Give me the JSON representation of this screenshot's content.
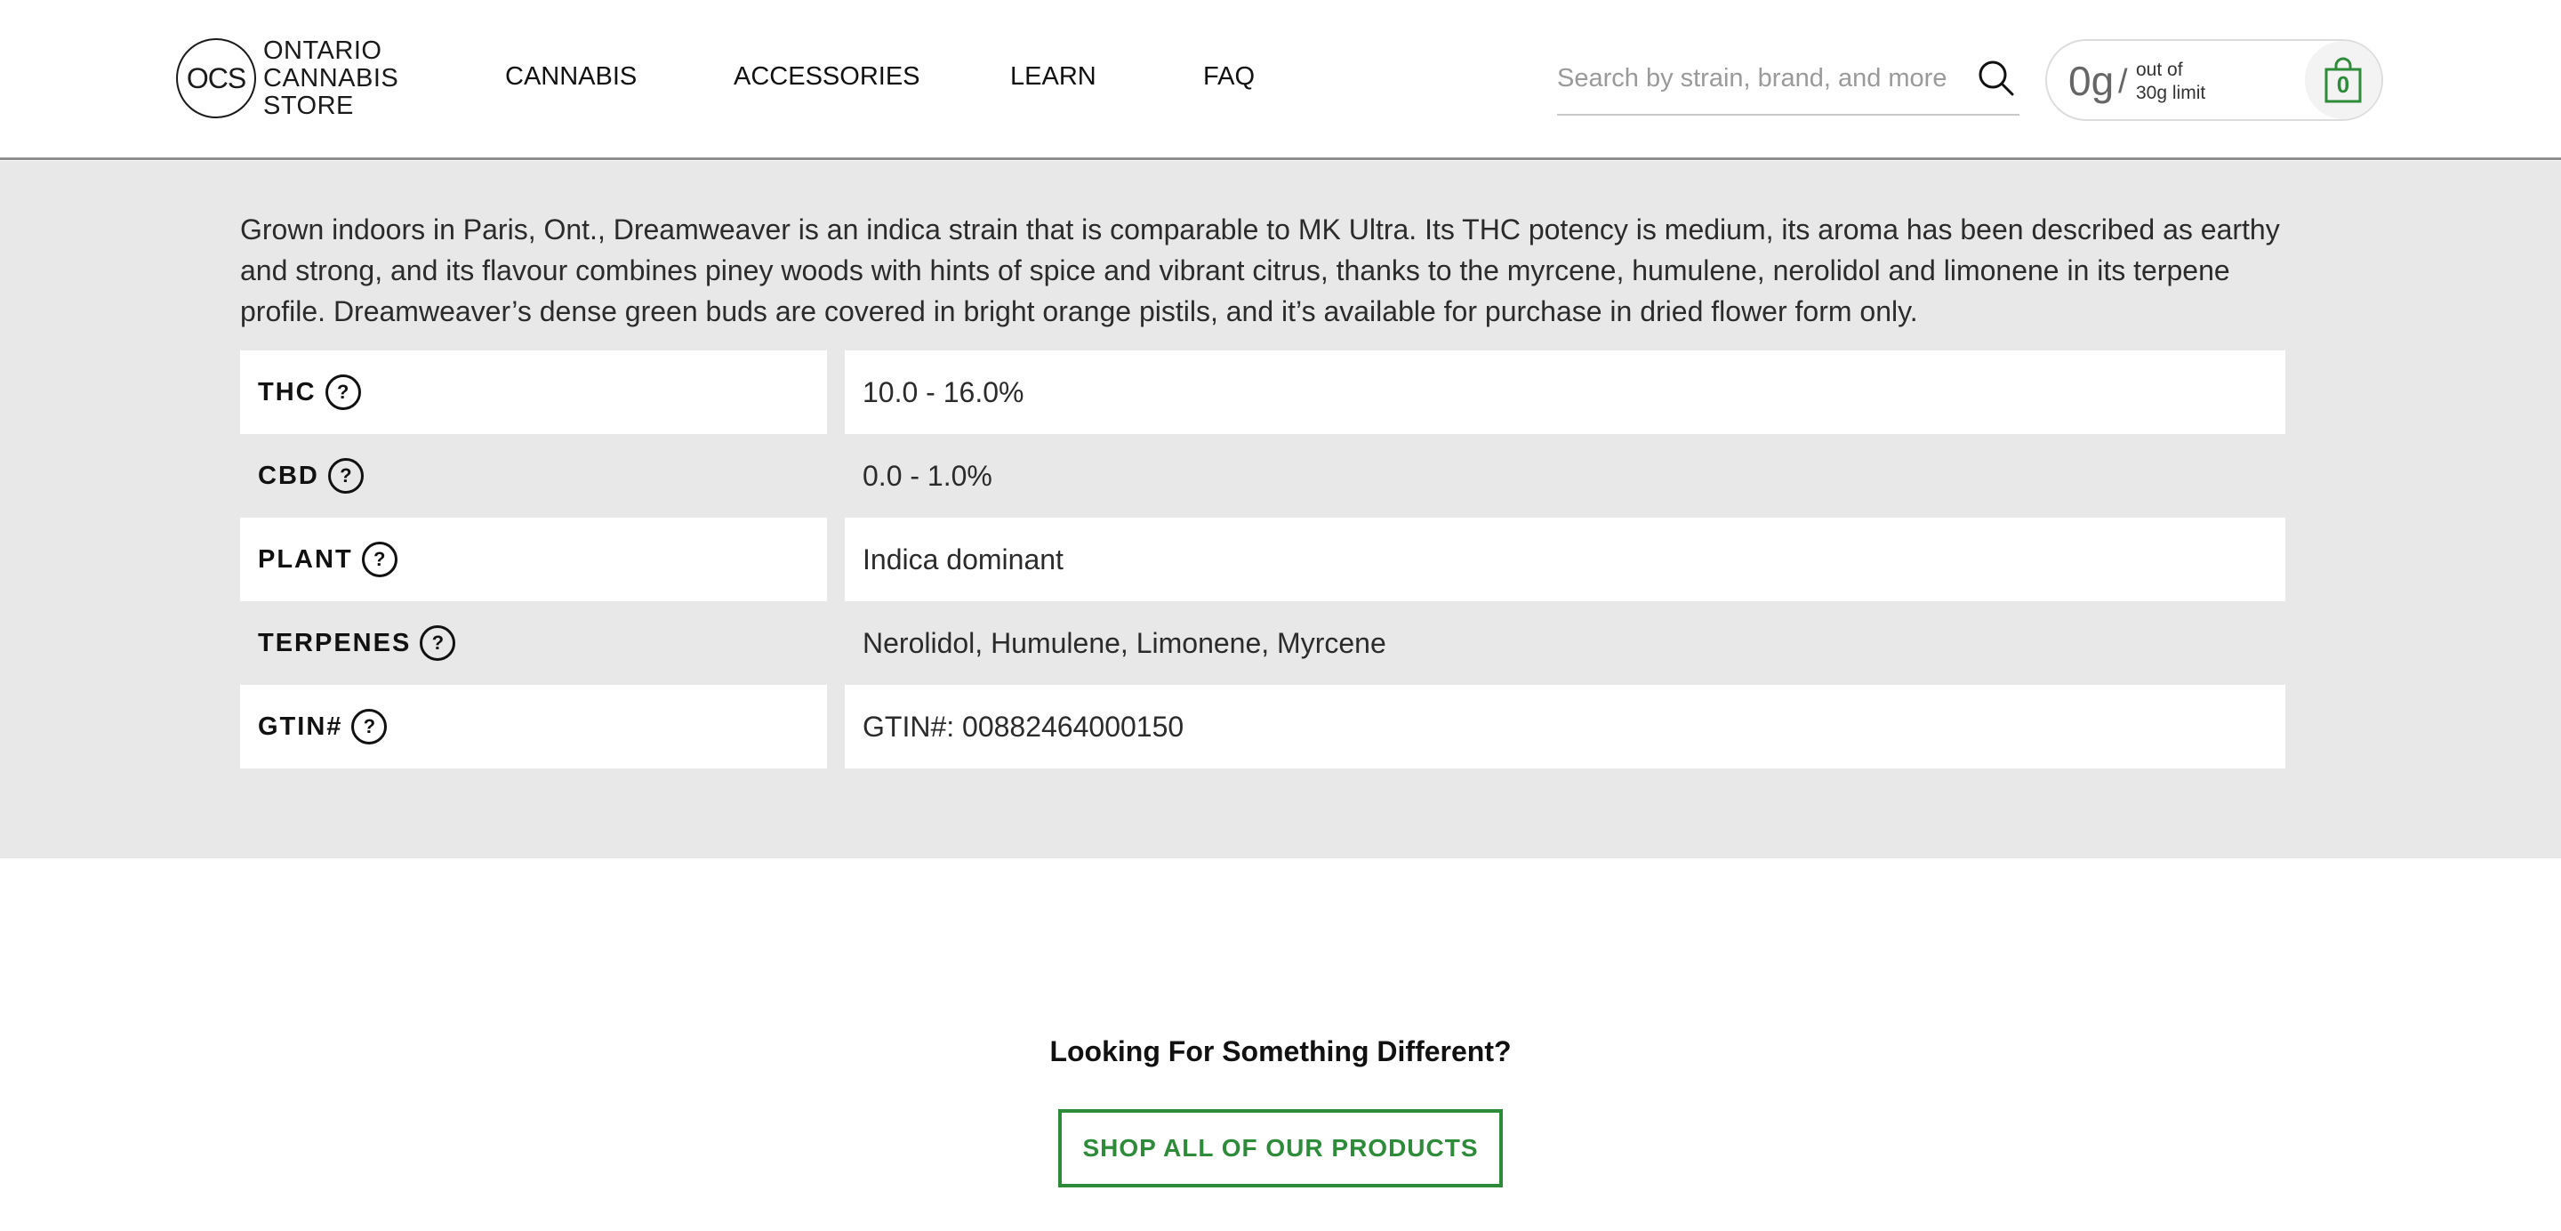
{
  "header": {
    "logo": {
      "monogram": "OCS",
      "words": [
        "ONTARIO",
        "CANNABIS",
        "STORE"
      ]
    },
    "nav": [
      {
        "label": "CANNABIS"
      },
      {
        "label": "ACCESSORIES"
      },
      {
        "label": "LEARN"
      },
      {
        "label": "FAQ"
      }
    ],
    "search": {
      "placeholder": "Search by strain, brand, and more",
      "value": ""
    },
    "cart": {
      "weight": "0g",
      "slash": "/",
      "limit_line1": "out of",
      "limit_line2": "30g limit",
      "count": "0"
    }
  },
  "product": {
    "description": "Grown indoors in Paris, Ont., Dreamweaver is an indica strain that is comparable to MK Ultra. Its THC potency is medium, its aroma has been described as earthy and strong, and its flavour combines piney woods with hints of spice and vibrant citrus, thanks to the myrcene, humulene, nerolidol and limonene in its terpene profile. Dreamweaver’s dense green buds are covered in bright orange pistils, and it’s available for purchase in dried flower form only.",
    "specs": [
      {
        "label": "THC",
        "value": "10.0 - 16.0%"
      },
      {
        "label": "CBD",
        "value": "0.0 - 1.0%"
      },
      {
        "label": "PLANT",
        "value": "Indica dominant"
      },
      {
        "label": "TERPENES",
        "value": "Nerolidol, Humulene, Limonene, Myrcene"
      },
      {
        "label": "GTIN#",
        "value": "GTIN#: 00882464000150"
      }
    ],
    "help_glyph": "?"
  },
  "cta": {
    "title": "Looking For Something Different?",
    "button_label": "SHOP ALL OF OUR PRODUCTS"
  },
  "colors": {
    "brand_green": "#2e8b3a",
    "section_bg": "#e8e8e8"
  }
}
